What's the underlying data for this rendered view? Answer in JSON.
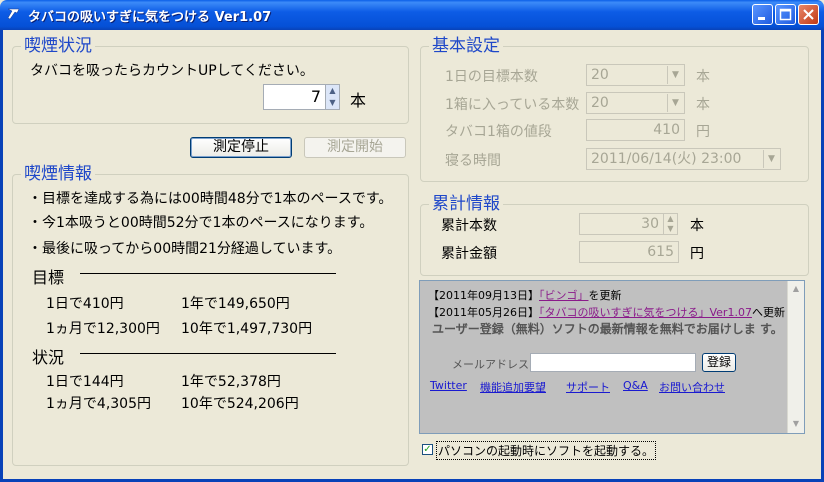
{
  "window": {
    "title": "タバコの吸いすぎに気をつける Ver1.07"
  },
  "smoking_status": {
    "title": "喫煙状況",
    "prompt": "タバコを吸ったらカウントUPしてください。",
    "count_value": "7",
    "count_unit": "本"
  },
  "buttons": {
    "stop": "測定停止",
    "start": "測定開始"
  },
  "smoking_info": {
    "title": "喫煙情報",
    "lines": [
      "・目標を達成する為には00時間48分で1本のペースです。",
      "・今1本吸うと00時間52分で1本のペースになります。",
      "・最後に吸ってから00時間21分経過しています。"
    ],
    "target_label": "目標",
    "target": {
      "day": "1日で410円",
      "year": "1年で149,650円",
      "month": "1ヵ月で12,300円",
      "decade": "10年で1,497,730円"
    },
    "status_label": "状況",
    "status": {
      "day": "1日で144円",
      "year": "1年で52,378円",
      "month": "1ヵ月で4,305円",
      "decade": "10年で524,206円"
    }
  },
  "basic_settings": {
    "title": "基本設定",
    "daily_target_label": "1日の目標本数",
    "daily_target_value": "20",
    "daily_target_unit": "本",
    "per_box_label": "1箱に入っている本数",
    "per_box_value": "20",
    "per_box_unit": "本",
    "box_price_label": "タバコ1箱の値段",
    "box_price_value": "410",
    "box_price_unit": "円",
    "bedtime_label": "寝る時間",
    "bedtime_value": "2011/06/14(火) 23:00"
  },
  "cumulative": {
    "title": "累計情報",
    "count_label": "累計本数",
    "count_value": "30",
    "count_unit": "本",
    "amount_label": "累計金額",
    "amount_value": "615",
    "amount_unit": "円"
  },
  "news": {
    "item1_date": "【2011年09月13日】",
    "item1_link": "「ビンゴ」",
    "item1_suffix": "を更新",
    "item2_date": "【2011年05月26日】",
    "item2_link": "「タバコの吸いすぎに気をつける」Ver1.07",
    "item2_suffix": "へ更新",
    "register_text": "ユーザー登録（無料）ソフトの最新情報を無料でお届けしま す。",
    "email_label": "メールアドレス:",
    "email_value": "",
    "register_button": "登録",
    "links": [
      "Twitter",
      "機能追加要望",
      "サポート",
      "Q&A",
      "お問い合わせ"
    ]
  },
  "startup": {
    "label": "パソコンの起動時にソフトを起動する。",
    "checked": true
  }
}
